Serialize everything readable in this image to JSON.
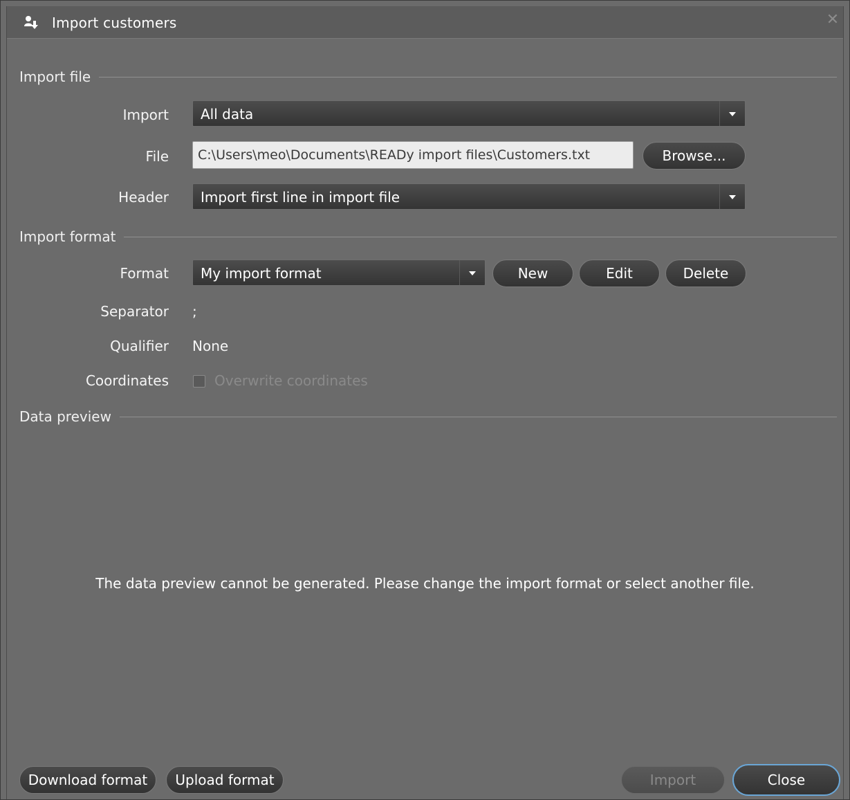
{
  "window": {
    "title": "Import customers",
    "title_icon": "import-customers-icon",
    "close_icon": "close-icon"
  },
  "import_file": {
    "section_label": "Import file",
    "import_label": "Import",
    "import_value": "All data",
    "file_label": "File",
    "file_value": "C:\\Users\\meo\\Documents\\READy import files\\Customers.txt",
    "browse_label": "Browse...",
    "header_label": "Header",
    "header_value": "Import first line in import file"
  },
  "import_format": {
    "section_label": "Import format",
    "format_label": "Format",
    "format_value": "My import format",
    "new_label": "New",
    "edit_label": "Edit",
    "delete_label": "Delete",
    "separator_label": "Separator",
    "separator_value": ";",
    "qualifier_label": "Qualifier",
    "qualifier_value": "None",
    "coordinates_label": "Coordinates",
    "overwrite_label": "Overwrite coordinates",
    "overwrite_checked": false
  },
  "data_preview": {
    "section_label": "Data preview",
    "message": "The data preview cannot be generated. Please change the import format or select another file."
  },
  "footer": {
    "download_label": "Download format",
    "upload_label": "Upload format",
    "import_label": "Import",
    "close_label": "Close"
  },
  "colors": {
    "background": "#6b6b6b",
    "control": "#3c3c3c",
    "focus_ring": "#6aa6d6"
  }
}
